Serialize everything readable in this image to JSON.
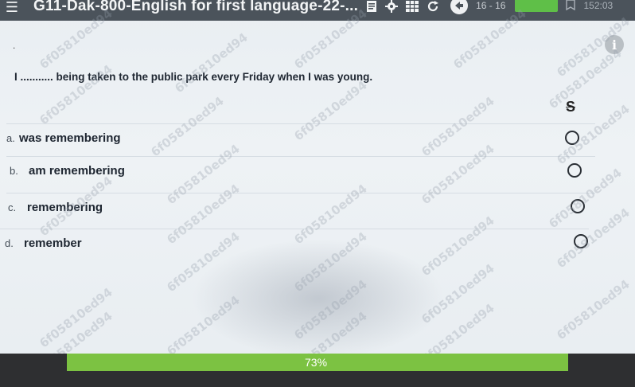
{
  "header": {
    "title": "G11-Dak-800-English for first language-22-...",
    "counter": "16 - 16",
    "timer": "152:03"
  },
  "question": {
    "text": "I ........... being taken to the public park every Friday when I was young."
  },
  "options": [
    {
      "letter": "a.",
      "text": "was remembering"
    },
    {
      "letter": "b.",
      "text": "am remembering"
    },
    {
      "letter": "c.",
      "text": "remembering"
    },
    {
      "letter": "d.",
      "text": "remember"
    }
  ],
  "progress": {
    "value": 0.73,
    "label": "73%"
  },
  "watermark": "6f05810ed94",
  "colors": {
    "topbar": "#4b535b",
    "progress_fill": "#7cc242",
    "progress_track": "#2e2f31",
    "accent_green": "#5fbf48"
  },
  "icons": [
    "menu-icon",
    "document-icon",
    "gear-icon",
    "grid-icon",
    "refresh-icon",
    "back-arrow-icon",
    "bookmark-icon",
    "info-icon",
    "strikethrough-icon"
  ]
}
